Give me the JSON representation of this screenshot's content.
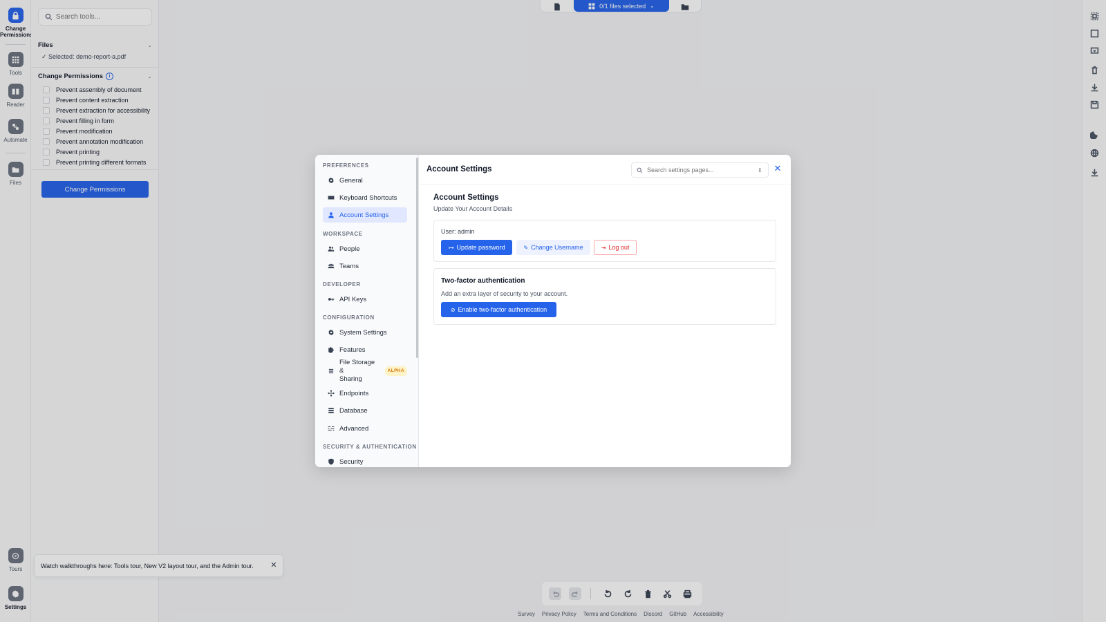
{
  "rail": {
    "items": [
      {
        "label": "Change Permissions",
        "icon": "lock-icon",
        "active": true
      },
      {
        "label": "Tools",
        "icon": "grid-icon"
      },
      {
        "label": "Reader",
        "icon": "book-icon"
      },
      {
        "label": "Automate",
        "icon": "automate-icon"
      },
      {
        "label": "Files",
        "icon": "folder-icon"
      },
      {
        "label": "Tours",
        "icon": "compass-icon"
      },
      {
        "label": "Settings",
        "icon": "gear-icon"
      }
    ]
  },
  "tool_panel": {
    "search_placeholder": "Search tools...",
    "files_label": "Files",
    "selected_file": "✓ Selected: demo-report-a.pdf",
    "permissions_label": "Change Permissions",
    "permissions": [
      "Prevent assembly of document",
      "Prevent content extraction",
      "Prevent extraction for accessibility",
      "Prevent filling in form",
      "Prevent modification",
      "Prevent annotation modification",
      "Prevent printing",
      "Prevent printing different formats"
    ],
    "apply_button": "Change Permissions"
  },
  "topbar": {
    "files_selected": "0/1 files selected"
  },
  "modal": {
    "title": "Account Settings",
    "search_placeholder": "Search settings pages...",
    "nav": {
      "preferences": "PREFERENCES",
      "general": "General",
      "keyboard_shortcuts": "Keyboard Shortcuts",
      "account_settings": "Account Settings",
      "workspace": "WORKSPACE",
      "people": "People",
      "teams": "Teams",
      "developer": "DEVELOPER",
      "api_keys": "API Keys",
      "configuration": "CONFIGURATION",
      "system_settings": "System Settings",
      "features": "Features",
      "file_storage_line1": "File Storage &",
      "file_storage_line2": "Sharing",
      "alpha_badge": "ALPHA",
      "endpoints": "Endpoints",
      "database": "Database",
      "advanced": "Advanced",
      "security_auth": "SECURITY & AUTHENTICATION",
      "security": "Security"
    },
    "content": {
      "section_title": "Account Settings",
      "section_subtitle": "Update Your Account Details",
      "user_label": "User: admin",
      "update_password": "Update password",
      "change_username": "Change Username",
      "log_out": "Log out",
      "tfa_title": "Two-factor authentication",
      "tfa_subtitle": "Add an extra layer of security to your account.",
      "tfa_button": "Enable two-factor authentication"
    }
  },
  "footer": {
    "links": [
      "Survey",
      "Privacy Policy",
      "Terms and Conditions",
      "Discord",
      "GitHub",
      "Accessibility"
    ]
  },
  "toast": {
    "message": "Watch walkthroughs here: Tools tour, New V2 layout tour, and the Admin tour."
  },
  "colors": {
    "accent": "#2563eb",
    "danger": "#dc2626",
    "alpha": "#d97706"
  }
}
